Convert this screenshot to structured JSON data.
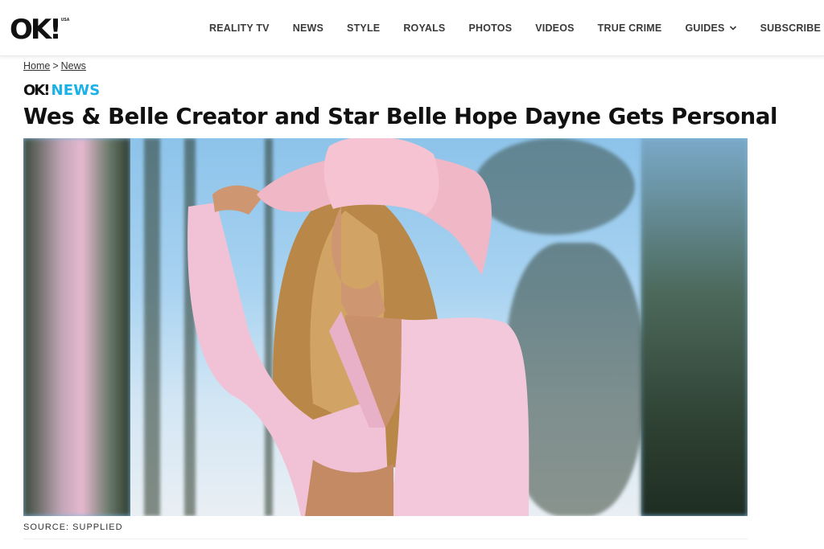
{
  "header": {
    "logo": "OK!",
    "logo_tm": "USA",
    "nav": [
      {
        "label": "REALITY TV"
      },
      {
        "label": "NEWS"
      },
      {
        "label": "STYLE"
      },
      {
        "label": "ROYALS"
      },
      {
        "label": "PHOTOS"
      },
      {
        "label": "VIDEOS"
      },
      {
        "label": "TRUE CRIME"
      },
      {
        "label": "GUIDES",
        "icon": "chevron-down-icon"
      },
      {
        "label": "SUBSCRIBE"
      }
    ]
  },
  "breadcrumb": {
    "home": "Home",
    "separator": ">",
    "section": "News"
  },
  "section_tag": {
    "ok": "OK!",
    "name": "NEWS"
  },
  "article": {
    "headline": "Wes & Belle Creator and Star Belle Hope Dayne Gets Personal",
    "image_caption": "SOURCE: SUPPLIED"
  },
  "colors": {
    "accent": "#1ab0e8",
    "text": "#111111",
    "nav_text": "#3a3a3a"
  }
}
